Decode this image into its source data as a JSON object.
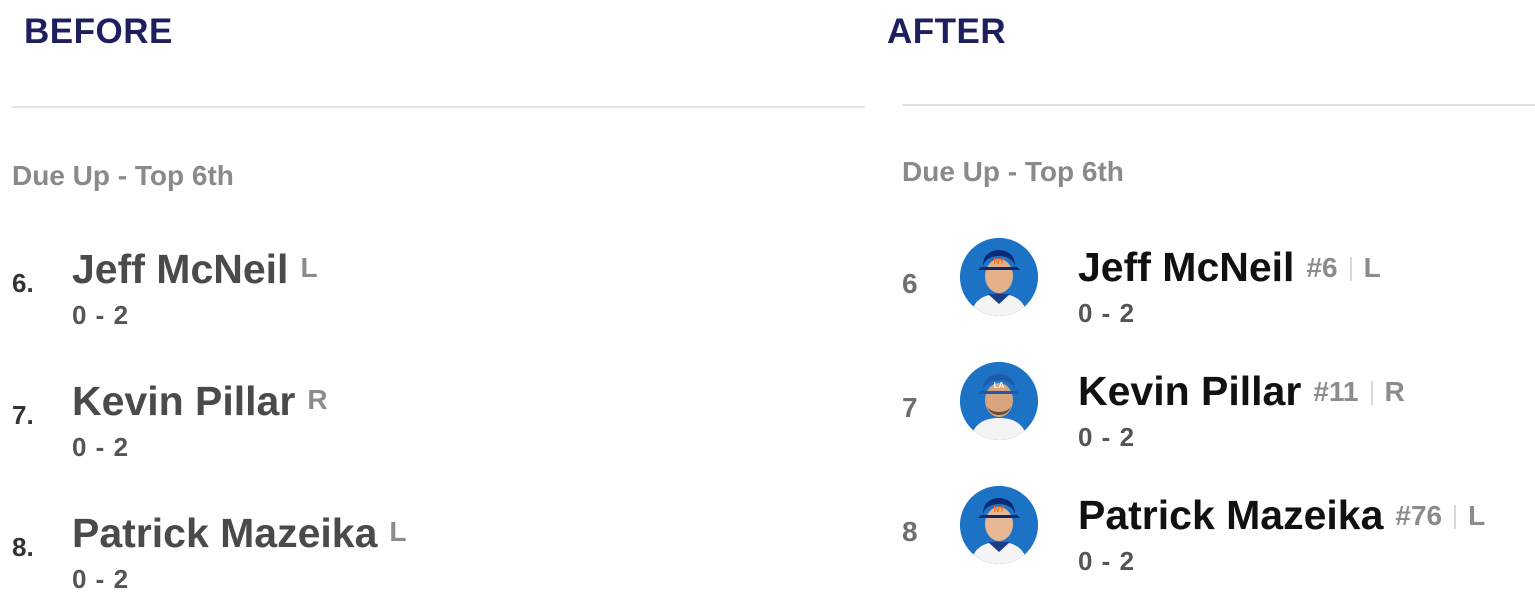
{
  "before": {
    "heading": "BEFORE",
    "section_title": "Due Up - Top 6th",
    "players": [
      {
        "order": "6.",
        "name": "Jeff McNeil",
        "bats": "L",
        "record": "0 - 2"
      },
      {
        "order": "7.",
        "name": "Kevin Pillar",
        "bats": "R",
        "record": "0 - 2"
      },
      {
        "order": "8.",
        "name": "Patrick Mazeika",
        "bats": "L",
        "record": "0 - 2"
      }
    ]
  },
  "after": {
    "heading": "AFTER",
    "section_title": "Due Up - Top 6th",
    "players": [
      {
        "order": "6",
        "name": "Jeff McNeil",
        "jersey": "#6",
        "bats": "L",
        "record": "0 - 2",
        "cap": "NY"
      },
      {
        "order": "7",
        "name": "Kevin Pillar",
        "jersey": "#11",
        "bats": "R",
        "record": "0 - 2",
        "cap": "LA"
      },
      {
        "order": "8",
        "name": "Patrick Mazeika",
        "jersey": "#76",
        "bats": "L",
        "record": "0 - 2",
        "cap": "NY"
      }
    ]
  },
  "colors": {
    "heading": "#1d1f5e",
    "avatar_bg": "#1c73c6",
    "divider": "#e4e4e4"
  },
  "icons": [
    "player-headshot-icon"
  ]
}
